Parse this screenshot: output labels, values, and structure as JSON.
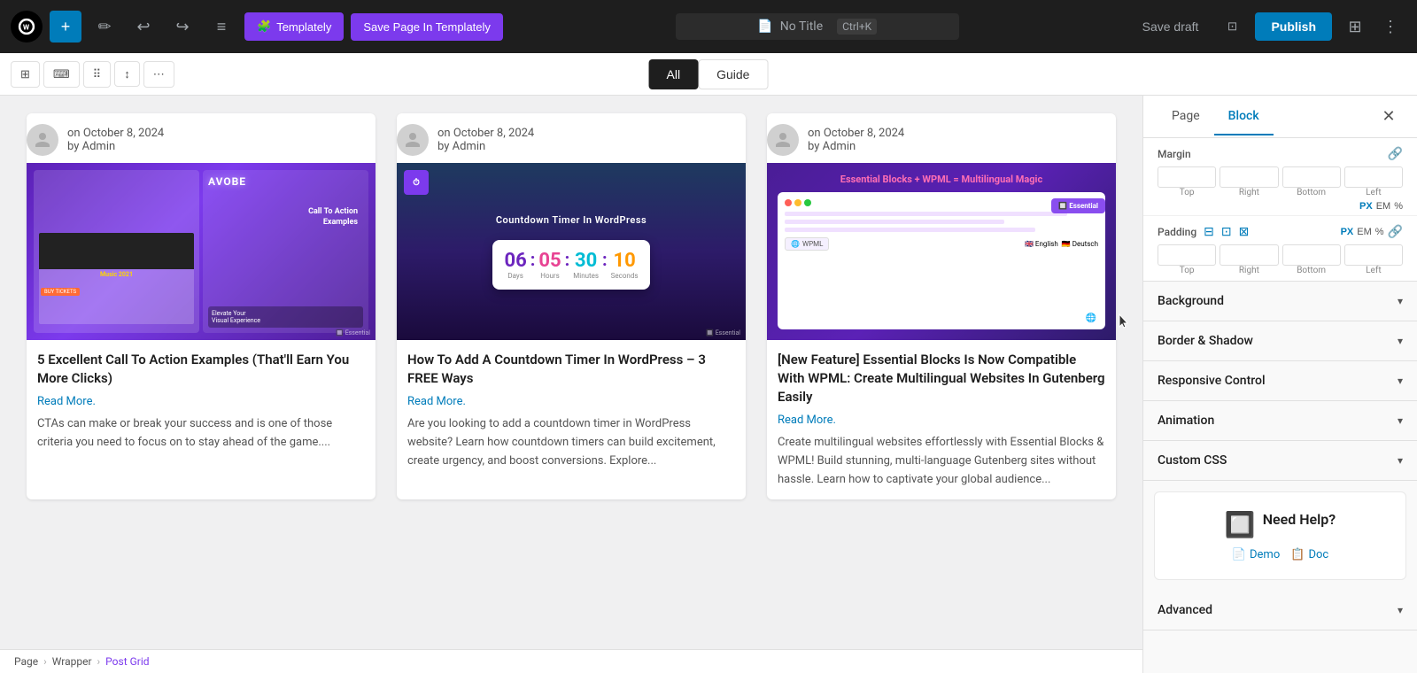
{
  "toolbar": {
    "wp_logo_alt": "WordPress",
    "add_button_label": "+",
    "edit_icon": "✏",
    "undo_icon": "↩",
    "redo_icon": "↪",
    "tools_icon": "≡",
    "templately_label": "Templately",
    "save_templately_label": "Save Page In Templately",
    "no_title": "No Title",
    "shortcut": "Ctrl+K",
    "save_draft_label": "Save draft",
    "publish_label": "Publish",
    "preview_icon": "⊡",
    "settings_icon": "⊞",
    "options_icon": "⋮"
  },
  "secondary_toolbar": {
    "icon_btn_1": "⊞",
    "icon_btn_2": "⌨",
    "icon_btn_3": "⠿",
    "icon_btn_4": "↕",
    "icon_btn_5": "⋯"
  },
  "filter_tabs": {
    "all_label": "All",
    "guide_label": "Guide"
  },
  "posts": [
    {
      "date": "on October 8, 2024",
      "author": "by Admin",
      "title": "5 Excellent Call To Action Examples (That'll Earn You More Clicks)",
      "read_more": "Read More.",
      "excerpt": "CTAs can make or break your success and is one of those criteria you need to focus on to stay ahead of the game....",
      "thumb_type": "cta"
    },
    {
      "date": "on October 8, 2024",
      "author": "by Admin",
      "title": "How To Add A Countdown Timer In WordPress – 3 FREE Ways",
      "read_more": "Read More.",
      "excerpt": "Are you looking to add a countdown timer in WordPress website? Learn how countdown timers can build excitement, create urgency, and boost conversions. Explore...",
      "thumb_type": "countdown"
    },
    {
      "date": "on October 8, 2024",
      "author": "by Admin",
      "title": "[New Feature] Essential Blocks Is Now Compatible With WPML: Create Multilingual Websites In Gutenberg Easily",
      "read_more": "Read More.",
      "excerpt": "Create multilingual websites effortlessly with Essential Blocks & WPML! Build stunning, multi-language Gutenberg sites without hassle. Learn how to captivate your global audience...",
      "thumb_type": "wpml"
    }
  ],
  "right_panel": {
    "page_tab": "Page",
    "block_tab": "Block",
    "close_icon": "✕",
    "margin_label": "Margin",
    "padding_label": "Padding",
    "margin_top": "",
    "margin_right": "",
    "margin_bottom": "",
    "margin_left": "",
    "padding_top": "",
    "padding_right": "",
    "padding_bottom": "",
    "padding_left": "",
    "unit_px": "PX",
    "unit_em": "EM",
    "unit_percent": "%",
    "background_label": "Background",
    "border_shadow_label": "Border & Shadow",
    "responsive_label": "Responsive Control",
    "animation_label": "Animation",
    "custom_css_label": "Custom CSS",
    "advanced_label": "Advanced",
    "need_help_label": "Need Help?",
    "demo_label": "Demo",
    "doc_label": "Doc"
  },
  "breadcrumb": {
    "page_label": "Page",
    "wrapper_label": "Wrapper",
    "post_grid_label": "Post Grid"
  }
}
